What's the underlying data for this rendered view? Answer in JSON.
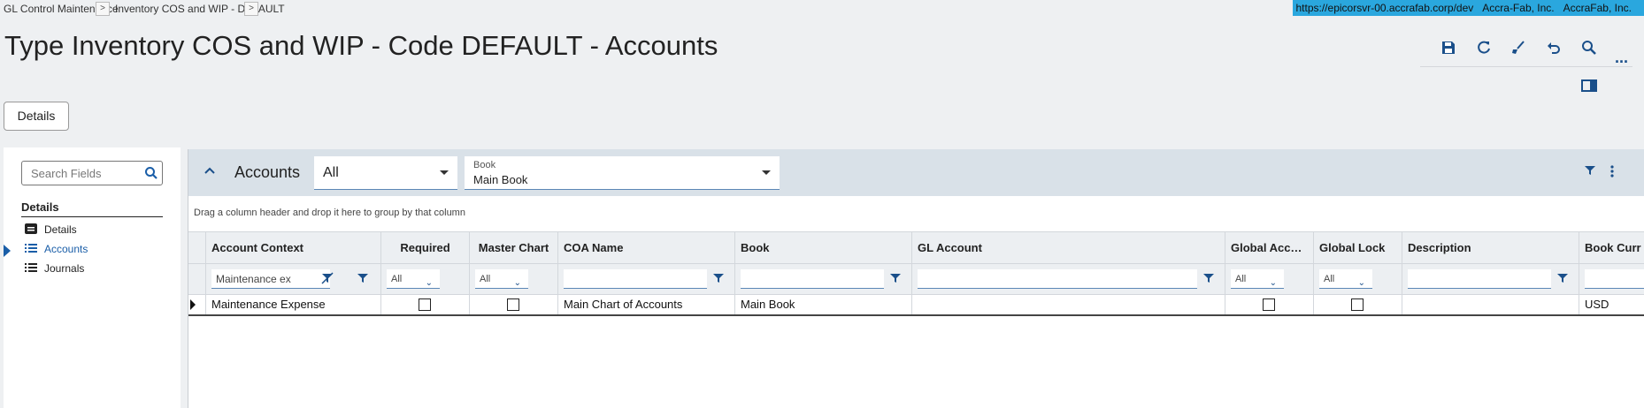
{
  "breadcrumb": {
    "item1": "GL Control Maintenance",
    "item2": "Inventory COS and WIP - DEFAULT",
    "arrow": ">"
  },
  "environment": {
    "url": "https://epicorsvr-00.accrafab.corp/dev",
    "company": "Accra-Fab, Inc.",
    "site": "AccraFab, Inc.",
    "color": "#2aa7de"
  },
  "page_title": "Type Inventory COS and WIP - Code DEFAULT - Accounts",
  "toolbar": {
    "icons": [
      "save-icon",
      "refresh-icon",
      "clear-icon",
      "undo-icon",
      "search-icon",
      "more-icon",
      "panel-toggle-icon"
    ],
    "more_label": "..."
  },
  "details_button": "Details",
  "left_panel": {
    "search_placeholder": "Search Fields",
    "section_title": "Details",
    "items": [
      {
        "label": "Details",
        "icon": "card-icon",
        "active": false
      },
      {
        "label": "Accounts",
        "icon": "list-icon",
        "active": true
      },
      {
        "label": "Journals",
        "icon": "list-icon",
        "active": false
      }
    ]
  },
  "accounts": {
    "title": "Accounts",
    "filter_select": "All",
    "book_label": "Book",
    "book_value": "Main Book",
    "group_hint": "Drag a column header and drop it here to group by that column",
    "columns": [
      "Account Context",
      "Required",
      "Master Chart",
      "COA Name",
      "Book",
      "GL Account",
      "Global Acc…",
      "Global Lock",
      "Description",
      "Book Curr"
    ],
    "filters": {
      "account_context": "Maintenance ex",
      "required": "All",
      "master_chart": "All",
      "global_acc": "All",
      "global_lock": "All"
    },
    "rows": [
      {
        "account_context": "Maintenance Expense",
        "required": false,
        "master_chart": false,
        "coa_name": "Main Chart of Accounts",
        "book": "Main Book",
        "gl_account": "",
        "global_acc": false,
        "global_lock": false,
        "description": "",
        "book_currency": "USD"
      }
    ]
  }
}
